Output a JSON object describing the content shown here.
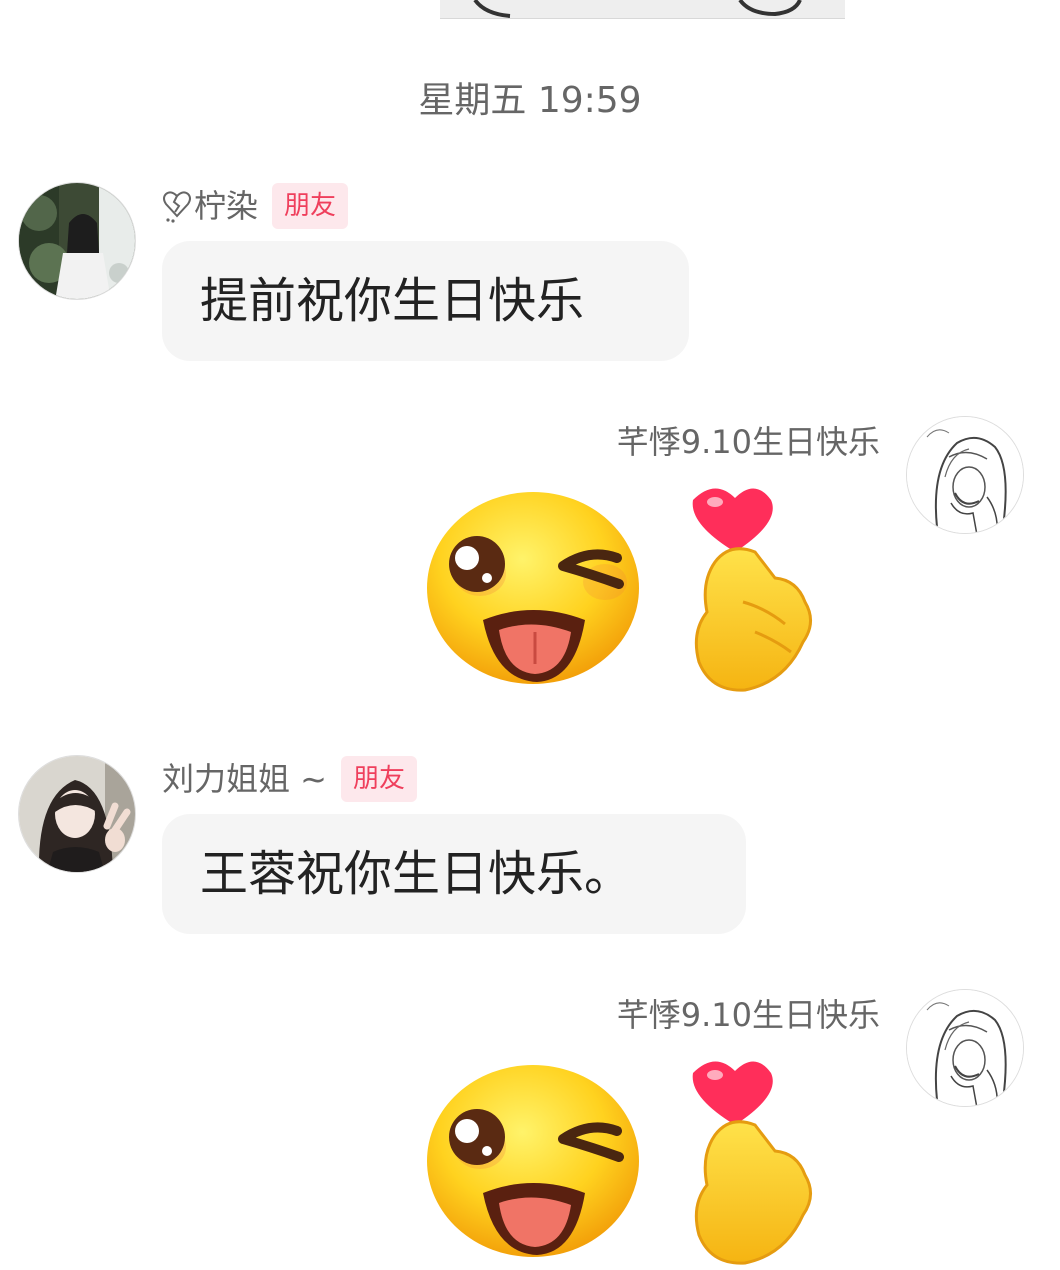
{
  "timestamp": "星期五 19:59",
  "messages": [
    {
      "sender": "柠染",
      "badge": "朋友",
      "text": "提前祝你生日快乐",
      "avatar_icon": "girl-in-forest-avatar-icon"
    },
    {
      "sender": "芊悸9.10生日快乐",
      "sticker_icon": "wink-tongue-heart-sticker-icon",
      "avatar_icon": "sketch-girl-avatar-icon"
    },
    {
      "sender": "刘力姐姐 ~",
      "badge": "朋友",
      "text": "王蓉祝你生日快乐。",
      "avatar_icon": "girl-peace-sign-avatar-icon"
    },
    {
      "sender": "芊悸9.10生日快乐",
      "sticker_icon": "wink-tongue-heart-sticker-icon",
      "avatar_icon": "sketch-girl-avatar-icon"
    }
  ],
  "colors": {
    "badge_bg": "#fde8ec",
    "badge_text": "#ef3f5c",
    "bubble_bg": "#f5f5f5",
    "meta_text": "#666666"
  }
}
